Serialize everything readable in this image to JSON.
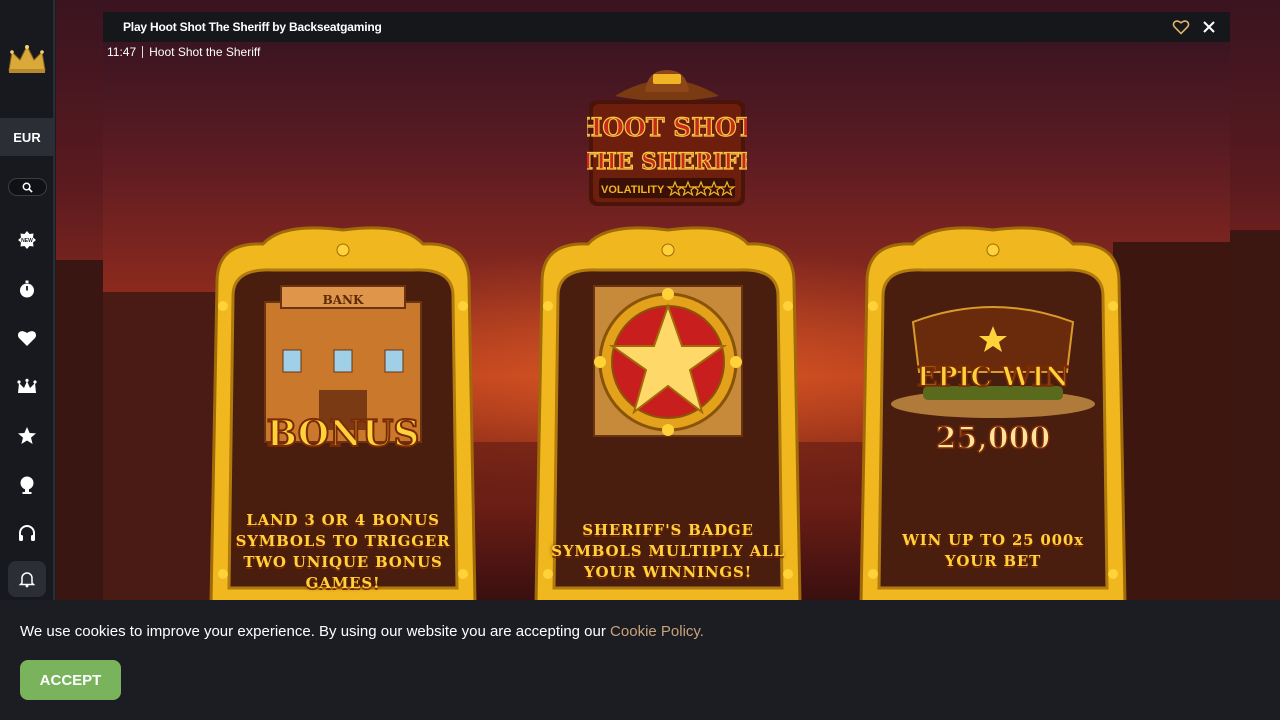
{
  "sidebar": {
    "currency": "EUR",
    "icons": [
      "crown-logo",
      "search-icon",
      "new-badge-icon",
      "stopwatch-icon",
      "heart-icon",
      "crown-icon",
      "star-icon",
      "trophy-icon",
      "headset-icon",
      "bell-icon"
    ]
  },
  "modal": {
    "title": "Play Hoot Shot The Sheriff by Backseatgaming",
    "time": "11:47",
    "game_name": "Hoot Shot the Sheriff"
  },
  "game": {
    "logo_line1": "HOOT SHOT",
    "logo_line2": "THE SHERIFF",
    "volatility_label": "VOLATILITY",
    "cards": [
      {
        "banner": "BONUS",
        "sign": "BANK",
        "text": "LAND 3 OR 4 BONUS SYMBOLS TO TRIGGER TWO UNIQUE BONUS GAMES!"
      },
      {
        "banner": "",
        "text": "SHERIFF'S BADGE SYMBOLS MULTIPLY ALL YOUR WINNINGS!"
      },
      {
        "banner": "EPIC WIN",
        "amount": "25,000",
        "text": "WIN UP TO 25 000x YOUR BET"
      }
    ]
  },
  "cookie": {
    "message": "We use cookies to improve your experience. By using our website you are accepting our ",
    "link": "Cookie Policy.",
    "accept": "ACCEPT"
  },
  "colors": {
    "accent_gold": "#ffd23a",
    "accept_green": "#79b35c",
    "link": "#c9a27a"
  }
}
